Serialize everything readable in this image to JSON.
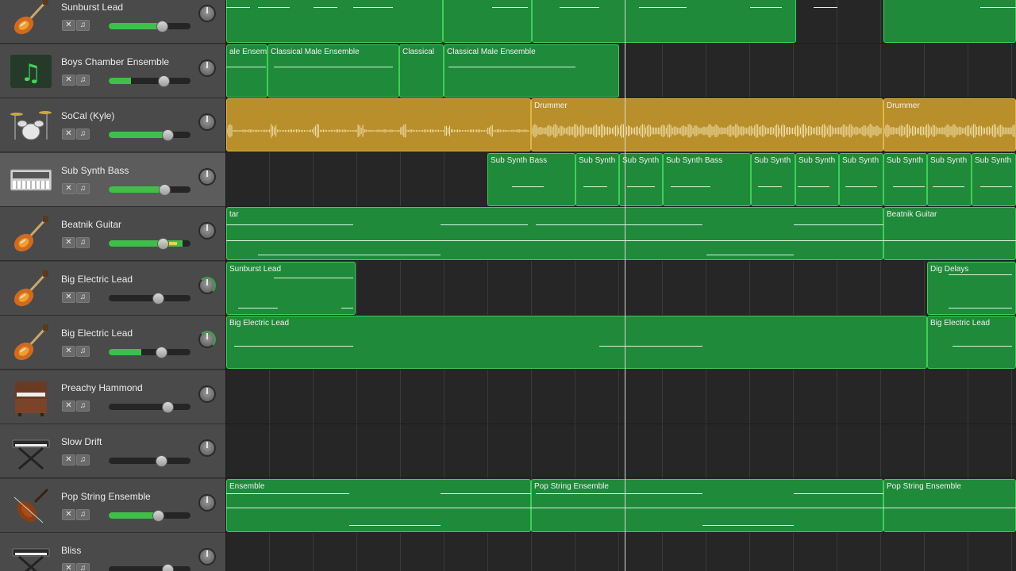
{
  "tracks": [
    {
      "name": "Sunburst Lead",
      "icon": "electric-guitar-icon",
      "volume": 0.65,
      "meter": 0.65,
      "pan_active": false,
      "selected": false
    },
    {
      "name": "Boys Chamber Ensemble",
      "icon": "music-note-icon",
      "volume": 0.67,
      "meter": 0.27,
      "pan_active": false,
      "selected": false
    },
    {
      "name": "SoCal (Kyle)",
      "icon": "drum-kit-icon",
      "volume": 0.72,
      "meter": 0.72,
      "pan_active": false,
      "selected": false
    },
    {
      "name": "Sub Synth Bass",
      "icon": "synthesizer-icon",
      "volume": 0.68,
      "meter": 0.68,
      "pan_active": false,
      "selected": true
    },
    {
      "name": "Beatnik Guitar",
      "icon": "electric-guitar-icon",
      "volume": 0.66,
      "meter": 0.9,
      "pan_active": false,
      "selected": false
    },
    {
      "name": "Big Electric Lead",
      "icon": "electric-guitar-icon",
      "volume": 0.6,
      "meter": 0.0,
      "pan_active": true,
      "selected": false
    },
    {
      "name": "Big Electric Lead",
      "icon": "electric-guitar-icon",
      "volume": 0.64,
      "meter": 0.4,
      "pan_active": true,
      "selected": false
    },
    {
      "name": "Preachy Hammond",
      "icon": "organ-icon",
      "volume": 0.72,
      "meter": 0.0,
      "pan_active": false,
      "selected": false
    },
    {
      "name": "Slow Drift",
      "icon": "keyboard-stand-icon",
      "volume": 0.64,
      "meter": 0.0,
      "pan_active": false,
      "selected": false
    },
    {
      "name": "Pop String Ensemble",
      "icon": "violin-icon",
      "volume": 0.6,
      "meter": 0.62,
      "pan_active": false,
      "selected": false
    },
    {
      "name": "Bliss",
      "icon": "keyboard-stand-icon",
      "volume": 0.72,
      "meter": 0.0,
      "pan_active": false,
      "selected": false
    }
  ],
  "regions": [
    [
      {
        "label": "",
        "type": "midi"
      },
      {
        "label": "",
        "type": "midi"
      },
      {
        "label": "",
        "type": "midi"
      },
      {
        "label": "",
        "type": "midi"
      }
    ],
    [
      {
        "label": "ale Ensemb",
        "type": "midi"
      },
      {
        "label": "Classical Male Ensemble",
        "type": "midi"
      },
      {
        "label": "Classical",
        "type": "midi"
      },
      {
        "label": "Classical Male Ensemble",
        "type": "midi"
      }
    ],
    [
      {
        "label": "",
        "type": "audio"
      },
      {
        "label": "Drummer",
        "type": "audio"
      },
      {
        "label": "Drummer",
        "type": "audio"
      }
    ],
    [
      {
        "label": "Sub Synth Bass",
        "type": "midi"
      },
      {
        "label": "Sub Synth",
        "type": "midi"
      },
      {
        "label": "Sub Synth",
        "type": "midi"
      },
      {
        "label": "Sub Synth Bass",
        "type": "midi"
      },
      {
        "label": "Sub Synth",
        "type": "midi"
      },
      {
        "label": "Sub Synth",
        "type": "midi"
      },
      {
        "label": "Sub Synth",
        "type": "midi"
      },
      {
        "label": "Sub Synth",
        "type": "midi"
      },
      {
        "label": "Sub Synth",
        "type": "midi"
      },
      {
        "label": "Sub Synth",
        "type": "midi"
      }
    ],
    [
      {
        "label": "tar",
        "type": "midi"
      },
      {
        "label": "Beatnik Guitar",
        "type": "midi"
      }
    ],
    [
      {
        "label": "Sunburst Lead",
        "type": "midi"
      },
      {
        "label": "Dig Delays",
        "type": "midi"
      }
    ],
    [
      {
        "label": "Big Electric Lead",
        "type": "midi"
      },
      {
        "label": "Big Electric Lead",
        "type": "midi"
      }
    ],
    [],
    [],
    [
      {
        "label": "Ensemble",
        "type": "midi"
      },
      {
        "label": "Pop String Ensemble",
        "type": "midi"
      },
      {
        "label": "Pop String Ensemble",
        "type": "midi"
      }
    ],
    []
  ],
  "track_buttons": {
    "mute_symbol": "✕",
    "headphones_symbol": "♫"
  },
  "colors": {
    "midi_region": "#1f8a3a",
    "audio_region": "#b88f2b",
    "meter": "#3fbf4a",
    "peak": "#e8d24a"
  }
}
